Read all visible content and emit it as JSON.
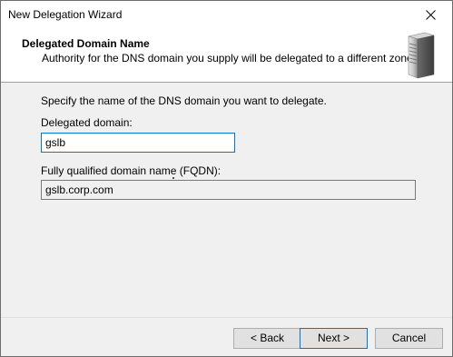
{
  "window": {
    "title": "New Delegation Wizard"
  },
  "header": {
    "title": "Delegated Domain Name",
    "subtitle": "Authority for the DNS domain you supply will be delegated to a different zone.",
    "icon": "server-icon"
  },
  "main": {
    "instruction": "Specify the name of the DNS domain you want to delegate.",
    "delegated_domain_label": "Delegated domain:",
    "delegated_domain_value": "gslb",
    "fqdn_label": "Fully qualified domain name (FQDN):",
    "fqdn_value": "gslb.corp.com"
  },
  "buttons": {
    "back": "< Back",
    "next": "Next >",
    "cancel": "Cancel"
  }
}
